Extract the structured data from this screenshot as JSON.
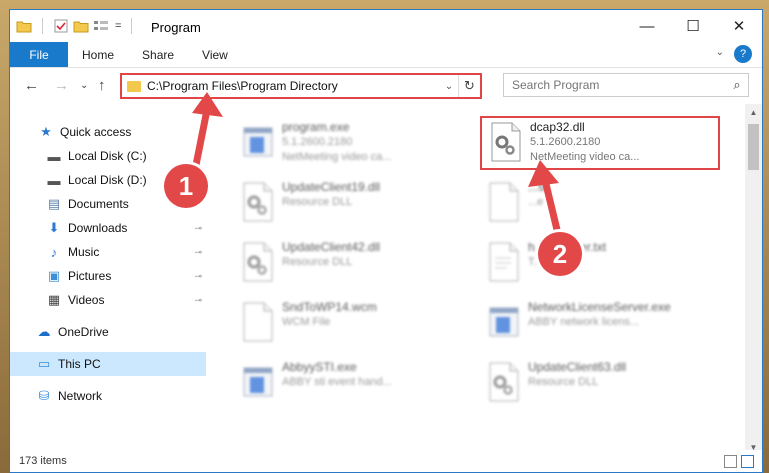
{
  "titlebar": {
    "title": "Program",
    "quick_access_dropdown": "=",
    "minimize": "—",
    "maximize": "☐",
    "close": "✕"
  },
  "ribbon": {
    "tabs": [
      "File",
      "Home",
      "Share",
      "View"
    ],
    "help": "?"
  },
  "navbar": {
    "back": "←",
    "forward": "→",
    "recent": "⌄",
    "up": "↑",
    "address_path": "C:\\Program Files\\Program Directory",
    "address_dropdown": "⌄",
    "refresh": "↻",
    "search_placeholder": "Search Program",
    "search_icon": "⌕"
  },
  "sidebar": {
    "items": [
      {
        "label": "Quick access",
        "icon": "star-icon",
        "glyph": "★",
        "color": "#2b79d3",
        "pinned": false
      },
      {
        "label": "Local Disk (C:)",
        "icon": "drive-icon",
        "glyph": "▬",
        "color": "#555555",
        "pinned": false
      },
      {
        "label": "Local Disk (D:)",
        "icon": "drive-icon",
        "glyph": "▬",
        "color": "#555555",
        "pinned": false
      },
      {
        "label": "Documents",
        "icon": "documents-icon",
        "glyph": "▤",
        "color": "#5a7ea8",
        "pinned": false
      },
      {
        "label": "Downloads",
        "icon": "download-icon",
        "glyph": "⬇",
        "color": "#2b79d3",
        "pinned": true
      },
      {
        "label": "Music",
        "icon": "music-icon",
        "glyph": "♪",
        "color": "#2b79d3",
        "pinned": true
      },
      {
        "label": "Pictures",
        "icon": "pictures-icon",
        "glyph": "▣",
        "color": "#3a8fd6",
        "pinned": true
      },
      {
        "label": "Videos",
        "icon": "videos-icon",
        "glyph": "▦",
        "color": "#444444",
        "pinned": true
      },
      {
        "label": "OneDrive",
        "icon": "cloud-icon",
        "glyph": "☁",
        "color": "#1b6fc9",
        "pinned": false
      },
      {
        "label": "This PC",
        "icon": "computer-icon",
        "glyph": "▭",
        "color": "#3a8fd6",
        "pinned": false
      },
      {
        "label": "Network",
        "icon": "network-icon",
        "glyph": "⛁",
        "color": "#3a8fd6",
        "pinned": false
      }
    ],
    "pin_glyph": "📌"
  },
  "files": [
    {
      "name": "program.exe",
      "line2": "5.1.2600.2180",
      "line3": "NetMeeting video ca...",
      "icon": "exe-icon"
    },
    {
      "name": "dcap32.dll",
      "line2": "5.1.2600.2180",
      "line3": "NetMeeting video ca...",
      "icon": "dll-gear-icon"
    },
    {
      "name": "UpdateClient19.dll",
      "line2": "Resource DLL",
      "line3": "",
      "icon": "dll-gear-icon"
    },
    {
      "name": "...sk",
      "line2": "...e",
      "line3": "",
      "icon": "blank-file-icon"
    },
    {
      "name": "UpdateClient42.dll",
      "line2": "Resource DLL",
      "line3": "",
      "icon": "dll-gear-icon"
    },
    {
      "name": "h...eReader.txt",
      "line2": "T...",
      "line3": "",
      "icon": "text-file-icon"
    },
    {
      "name": "SndToWP14.wcm",
      "line2": "WCM File",
      "line3": "",
      "icon": "blank-file-icon"
    },
    {
      "name": "NetworkLicenseServer.exe",
      "line2": "ABBY network licens...",
      "line3": "",
      "icon": "exe-icon"
    },
    {
      "name": "AbbyySTI.exe",
      "line2": "ABBY sti event hand...",
      "line3": "",
      "icon": "exe-icon"
    },
    {
      "name": "UpdateClient63.dll",
      "line2": "Resource DLL",
      "line3": "",
      "icon": "dll-gear-icon"
    }
  ],
  "status": {
    "item_count": "173 items"
  },
  "annotations": {
    "step1": "1",
    "step2": "2",
    "color": "#e34848"
  }
}
